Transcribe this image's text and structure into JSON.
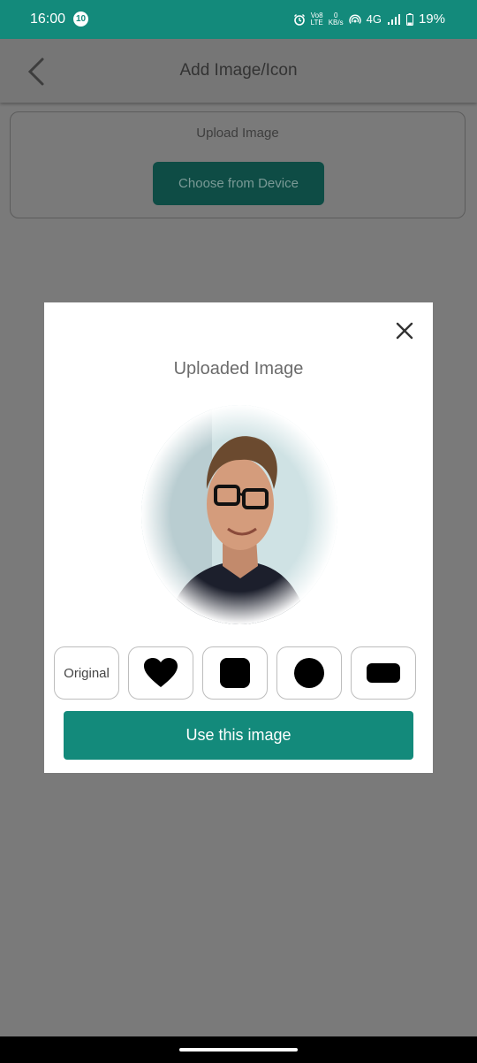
{
  "status_bar": {
    "time": "16:00",
    "notification_count": "10",
    "network": "4G",
    "data_speed_value": "0",
    "data_speed_unit": "KB/s",
    "volte": "Vo8",
    "lte": "LTE",
    "battery_percent": "19%"
  },
  "app_bar": {
    "title": "Add Image/Icon"
  },
  "upload_section": {
    "label": "Upload Image",
    "choose_button": "Choose from Device"
  },
  "dialog": {
    "title": "Uploaded Image",
    "shape_options": [
      {
        "label": "Original",
        "shape": "original"
      },
      {
        "label": "",
        "shape": "heart"
      },
      {
        "label": "",
        "shape": "rounded-square"
      },
      {
        "label": "",
        "shape": "circle"
      },
      {
        "label": "",
        "shape": "rounded-rectangle"
      }
    ],
    "use_button": "Use this image"
  },
  "colors": {
    "accent": "#138a7b",
    "overlay": "#7a7a7a"
  }
}
